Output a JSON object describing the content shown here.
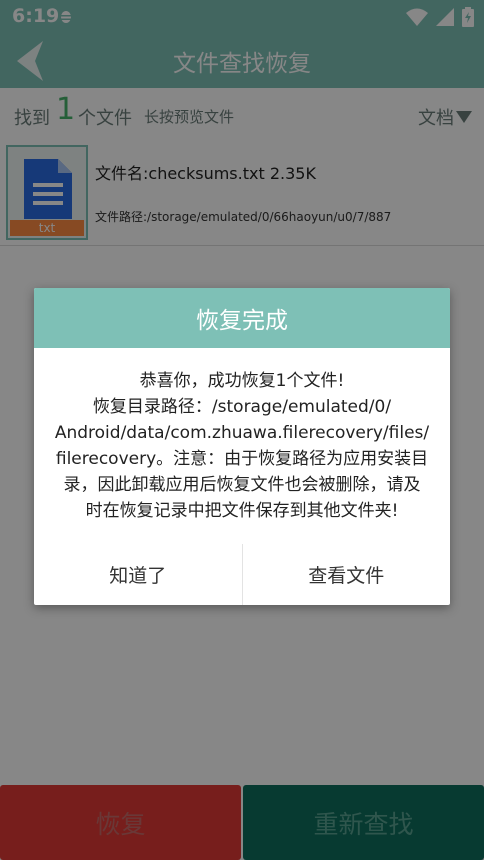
{
  "status_bar": {
    "time": "6:19"
  },
  "app_bar": {
    "title": "文件查找恢复"
  },
  "sub_bar": {
    "found_label": "找到",
    "found_count": "1",
    "found_unit": "个文件",
    "hint": "长按预览文件",
    "filter_label": "文档"
  },
  "file": {
    "ext": "txt",
    "name": "文件名:checksums.txt 2.35K",
    "path": "文件路径:/storage/emulated/0/66haoyun/u0/7/887"
  },
  "dialog": {
    "title": "恢复完成",
    "message_lines": [
      "恭喜你，成功恢复1个文件!",
      "恢复目录路径：/storage/emulated/0/",
      "Android/data/com.zhuawa.filerecovery/files/",
      "filerecovery。注意：由于恢复路径为应用安装目",
      "录，因此卸载应用后恢复文件也会被删除，请及",
      "时在恢复记录中把文件保存到其他文件夹!"
    ],
    "btn_ok": "知道了",
    "btn_view": "查看文件"
  },
  "bottom": {
    "recover_label": "恢复",
    "research_label": "重新查找"
  },
  "colors": {
    "teal": "#7ec0b6",
    "recover_red": "#e03a36",
    "research_green": "#0e6e5d"
  },
  "icons": [
    "bug-icon",
    "wifi-icon",
    "signal-icon",
    "battery-icon",
    "back-arrow-icon",
    "document-icon",
    "dropdown-triangle-icon"
  ]
}
